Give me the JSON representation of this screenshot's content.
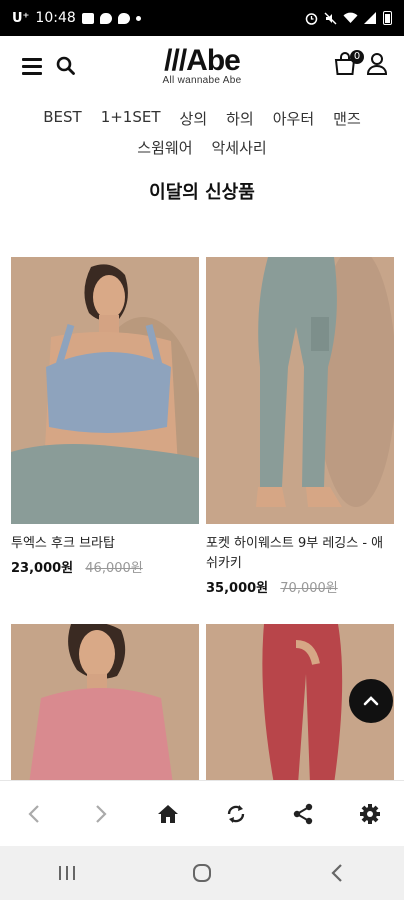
{
  "status_bar": {
    "carrier": "U⁺",
    "time": "10:48"
  },
  "header": {
    "logo_text": "///Abe",
    "logo_tagline": "All wannabe Abe",
    "cart_count": "0"
  },
  "categories": {
    "row1": [
      "BEST",
      "1+1SET",
      "상의",
      "하의",
      "아우터",
      "맨즈"
    ],
    "row2": [
      "스윔웨어",
      "악세사리"
    ]
  },
  "section_title": "이달의 신상품",
  "products": [
    {
      "name": "투엑스 후크 브라탑",
      "price": "23,000원",
      "original_price": "46,000원",
      "image": "model in blue sports bra and sage leggings"
    },
    {
      "name": "포켓 하이웨스트 9부 레깅스 - 애쉬카키",
      "price": "35,000원",
      "original_price": "70,000원",
      "image": "legs in sage pocket leggings"
    },
    {
      "name": "",
      "price": "",
      "original_price": "",
      "image": "model in pink short-sleeve top"
    },
    {
      "name": "",
      "price": "",
      "original_price": "",
      "image": "legs in red leggings"
    }
  ],
  "colors": {
    "bg_tan": "#c4a287",
    "sage": "#8a9c98",
    "blue_top": "#8ea3bd",
    "pink_top": "#d98a8f",
    "red_leggings": "#b8454a",
    "skin": "#d9a987"
  },
  "toolbar_icons": [
    "back-arrow-icon",
    "forward-arrow-icon",
    "home-icon",
    "refresh-icon",
    "share-icon",
    "settings-icon"
  ],
  "nav_icons": [
    "recents-icon",
    "home-circle-icon",
    "back-icon"
  ]
}
